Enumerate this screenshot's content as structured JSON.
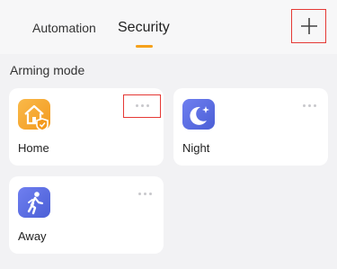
{
  "tabs": [
    {
      "label": "Automation",
      "selected": false
    },
    {
      "label": "Security",
      "selected": true
    }
  ],
  "header": {
    "add_icon": "plus-icon"
  },
  "section": {
    "title": "Arming mode"
  },
  "modes": [
    {
      "label": "Home",
      "icon": "home-shield-icon",
      "color": "#f5a623"
    },
    {
      "label": "Night",
      "icon": "moon-star-icon",
      "color": "#5b6ee1"
    },
    {
      "label": "Away",
      "icon": "walking-person-icon",
      "color": "#5b6ee1"
    }
  ],
  "colors": {
    "accent": "#f5a11b",
    "highlight_box": "#e53935"
  }
}
